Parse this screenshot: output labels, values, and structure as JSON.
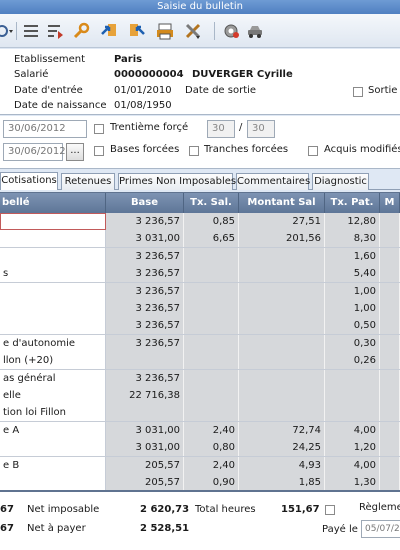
{
  "window": {
    "title": "Saisie du bulletin"
  },
  "toolbar": {
    "icons": [
      "settings-dropdown-icon",
      "list-icon",
      "filter-list-icon",
      "wrench-icon",
      "arrow-in-icon",
      "arrow-out-icon",
      "print-icon",
      "tools-icon",
      "gear-icon",
      "car-icon"
    ]
  },
  "header": {
    "etablissement_label": "Etablissement",
    "etablissement_value": "Paris",
    "salarie_label": "Salarié",
    "salarie_number": "0000000004",
    "salarie_name": "DUVERGER Cyrille",
    "date_entree_label": "Date d'entrée",
    "date_entree_value": "01/01/2010",
    "date_sortie_label": "Date de sortie",
    "date_naissance_label": "Date de naissance",
    "date_naissance_value": "01/08/1950",
    "sortie_label": "Sortie"
  },
  "options": {
    "date_start": "30/06/2012",
    "date_end": "30/06/2012",
    "ellipsis_label": "...",
    "trentieme_label": "Trentième forçé",
    "trentieme_num": "30",
    "slash": "/",
    "trentieme_den": "30",
    "bases_label": "Bases forcées",
    "tranches_label": "Tranches forcées",
    "acquis_label": "Acquis modifiés"
  },
  "tabs": [
    "Cotisations",
    "Retenues",
    "Primes Non Imposables",
    "Commentaires",
    "Diagnostic"
  ],
  "grid": {
    "columns": [
      "bellé",
      "Base",
      "Tx. Sal.",
      "Montant Sal",
      "Tx. Pat.",
      "M"
    ],
    "rows": [
      [
        "",
        "3 236,57",
        "0,85",
        "27,51",
        "12,80"
      ],
      [
        "",
        "3 031,00",
        "6,65",
        "201,56",
        "8,30"
      ],
      [
        "",
        "3 236,57",
        "",
        "",
        "1,60"
      ],
      [
        "s",
        "3 236,57",
        "",
        "",
        "5,40"
      ],
      [
        "",
        "3 236,57",
        "",
        "",
        "1,00"
      ],
      [
        "",
        "3 236,57",
        "",
        "",
        "1,00"
      ],
      [
        "",
        "3 236,57",
        "",
        "",
        "0,50"
      ],
      [
        "e d'autonomie",
        "3 236,57",
        "",
        "",
        "0,30"
      ],
      [
        "llon (+20)",
        "",
        "",
        "",
        "0,26"
      ],
      [
        "as général",
        "3 236,57",
        "",
        "",
        ""
      ],
      [
        "elle",
        "22 716,38",
        "",
        "",
        ""
      ],
      [
        "tion loi Fillon",
        "",
        "",
        "",
        ""
      ],
      [
        "e A",
        "3 031,00",
        "2,40",
        "72,74",
        "4,00"
      ],
      [
        "",
        "3 031,00",
        "0,80",
        "24,25",
        "1,20"
      ],
      [
        "e B",
        "205,57",
        "2,40",
        "4,93",
        "4,00"
      ],
      [
        "",
        "205,57",
        "0,90",
        "1,85",
        "1,30"
      ]
    ]
  },
  "footer": {
    "left_val1": "67",
    "left_val2": "67",
    "net_imposable_label": "Net imposable",
    "net_imposable_value": "2 620,73",
    "net_payer_label": "Net à payer",
    "net_payer_value": "2 528,51",
    "total_heures_label": "Total heures",
    "total_heures_value": "151,67",
    "reglement_label": "Règleme",
    "paye_le_label": "Payé le",
    "paye_le_value": "05/07/2"
  }
}
